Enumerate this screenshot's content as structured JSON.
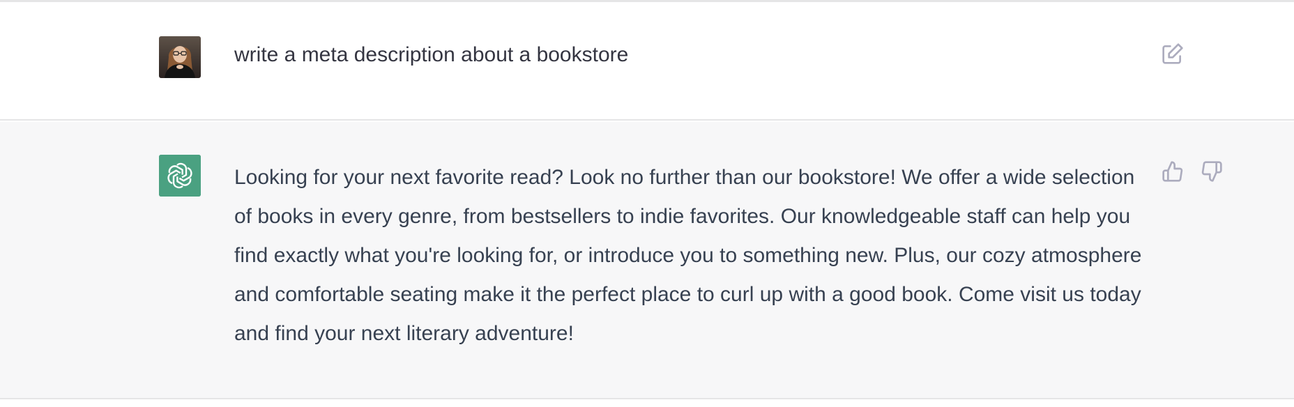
{
  "conversation": {
    "user_message": {
      "text": "write a meta description about a bookstore",
      "avatar_icon": "user-photo-avatar",
      "edit_icon": "edit-icon"
    },
    "assistant_message": {
      "text": "Looking for your next favorite read? Look no further than our bookstore! We offer a wide selection of books in every genre, from bestsellers to indie favorites. Our knowledgeable staff can help you find exactly what you're looking for, or introduce you to something new. Plus, our cozy atmosphere and comfortable seating make it the perfect place to curl up with a good book. Come visit us today and find your next literary adventure!",
      "avatar_icon": "openai-logo-icon",
      "feedback_icons": [
        "thumbs-up-icon",
        "thumbs-down-icon"
      ]
    }
  },
  "colors": {
    "assistant_bg": "#f7f7f8",
    "user_bg": "#ffffff",
    "assistant_avatar_bg": "#4aa181",
    "text": "#374151",
    "icon": "#acacbe",
    "divider": "#e5e5e6"
  }
}
